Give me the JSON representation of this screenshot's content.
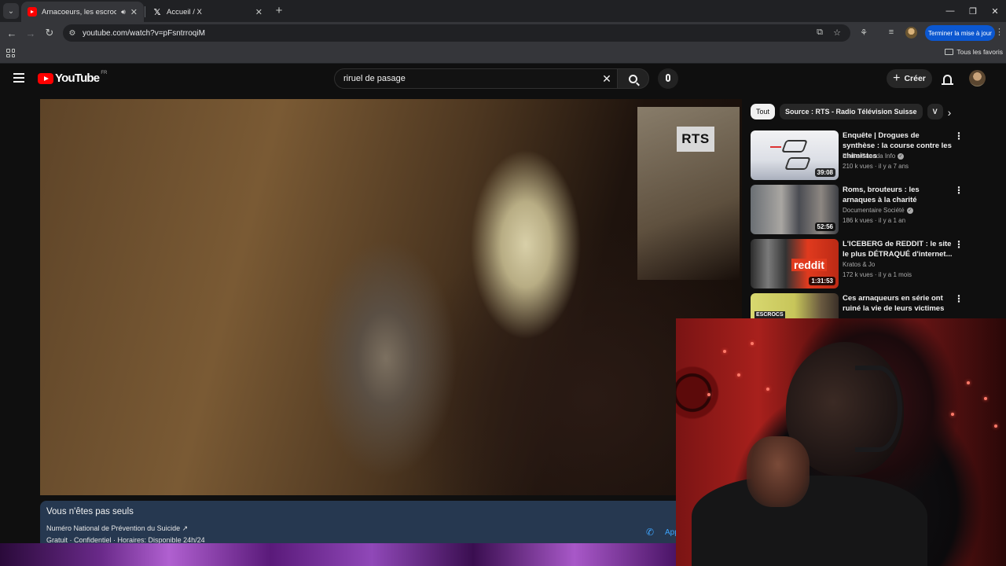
{
  "browser": {
    "tabs": [
      {
        "title": "Arnacoeurs, les escrocs de l",
        "active": true,
        "audio": true
      },
      {
        "title": "Accueil / X",
        "active": false
      }
    ],
    "url": "youtube.com/watch?v=pFsntrroqiM",
    "update_button": "Terminer la mise à jour",
    "bookmarks_all": "Tous les favoris"
  },
  "youtube": {
    "logo_text": "YouTube",
    "country_code": "FR",
    "search_query": "riruel de pasage",
    "create_label": "Créer"
  },
  "player": {
    "watermark": "RTS"
  },
  "crisis_panel": {
    "title": "Vous n'êtes pas seuls",
    "line1": "Numéro National de Prévention du Suicide ↗",
    "line2": "Gratuit · Confidentiel · Horaires: Disponible 24h/24",
    "action_label": "App"
  },
  "sidebar": {
    "chips": [
      "Tout",
      "Source : RTS - Radio Télévision Suisse",
      "V"
    ],
    "recommendations": [
      {
        "title": "Enquête | Drogues de synthèse : la course contre les chimistes",
        "channel": "Radio-Canada Info",
        "verified": true,
        "meta": "210 k vues · il y a 7 ans",
        "duration": "39:08"
      },
      {
        "title": "Roms, brouteurs : les arnaques à la charité",
        "channel": "Documentaire Société",
        "verified": true,
        "meta": "186 k vues · il y a 1 an",
        "duration": "52:56"
      },
      {
        "title": "L'ICEBERG de REDDIT : le site le plus DÉTRAQUÉ d'internet...",
        "channel": "Kratos & Jo",
        "verified": false,
        "meta": "172 k vues · il y a 1 mois",
        "duration": "1:31:53"
      },
      {
        "title": "Ces arnaqueurs en série ont ruiné la vie de leurs victimes",
        "channel": "",
        "verified": false,
        "meta": "",
        "duration": ""
      }
    ],
    "thumb_texts": {
      "reddit": "reddit",
      "escrocs": "ESCROCS"
    }
  }
}
